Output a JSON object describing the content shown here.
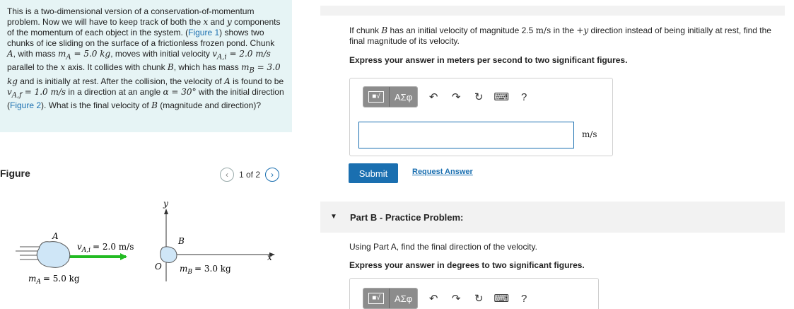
{
  "intro": {
    "p1": "This is a two-dimensional version of a conservation-of-momentum problem. Now we will have to keep track of both the ",
    "x": "x",
    "and": " and ",
    "y": "y",
    "p2": " components of the momentum of each object in the system. (",
    "fig1": "Figure 1",
    "p3": ") shows two chunks of ice sliding on the surface of a frictionless frozen pond. Chunk ",
    "A": "A",
    "p4": ", with mass ",
    "mA": "m",
    "mA_sub": "A",
    "eq1": " = 5.0 kg",
    "p5": ", moves with initial velocity ",
    "vAi": "v",
    "vAi_sub": "A,i",
    "eq2": " = 2.0 m/s",
    "p6": " parallel to the ",
    "x2": "x",
    "p7": " axis. It collides with chunk ",
    "B": "B",
    "p8": ", which has mass ",
    "mB": "m",
    "mB_sub": "B",
    "eq3": " = 3.0 kg",
    "p9": " and is initially at rest. After the collision, the velocity of ",
    "A2": "A",
    "p10": " is found to be ",
    "vAf": "v",
    "vAf_sub": "A,f",
    "eq4": " = 1.0 m/s",
    "p11": " in a direction at an angle ",
    "alpha": "α",
    "eq5": " = 30°",
    "p12": " with the initial direction (",
    "fig2": "Figure 2",
    "p13": "). What is the final velocity of ",
    "B2": "B",
    "p14": " (magnitude and direction)?"
  },
  "figure": {
    "title": "Figure",
    "page_label": "1 of 2",
    "labels": {
      "y": "y",
      "x": "x",
      "A": "A",
      "B": "B",
      "O": "O",
      "vAi": "v",
      "vAi_sub": "A,i",
      "vAi_val": "= 2.0 m/s",
      "mA": "m",
      "mA_sub": "A",
      "mA_val": "= 5.0 kg",
      "mB": "m",
      "mB_sub": "B",
      "mB_val": "= 3.0 kg"
    },
    "colors": {
      "arrow": "#22bb22",
      "ice": "#cfe6f7",
      "ice_stroke": "#555555"
    }
  },
  "partA": {
    "q_pre": "If chunk ",
    "B": "B",
    "q_mid1": " has an initial velocity of magnitude 2.5 ",
    "unit_ms": "m/s",
    "q_mid2": " in the ",
    "plusy": "+y",
    "q_post": " direction instead of being initially at rest, find the final magnitude of its velocity.",
    "instruction": "Express your answer in meters per second to two significant figures.",
    "unit": "m/s",
    "input_value": "",
    "submit": "Submit",
    "request": "Request Answer"
  },
  "toolbar": {
    "templates_icon": "templates-icon",
    "symbols_label": "ΑΣφ",
    "undo_icon": "undo-icon",
    "redo_icon": "redo-icon",
    "reset_icon": "reset-icon",
    "keyboard_icon": "keyboard-icon",
    "help_label": "?"
  },
  "partB": {
    "title": "Part B - Practice Problem:",
    "question": "Using Part A, find the final direction of the velocity.",
    "instruction": "Express your answer in degrees to two significant figures."
  }
}
